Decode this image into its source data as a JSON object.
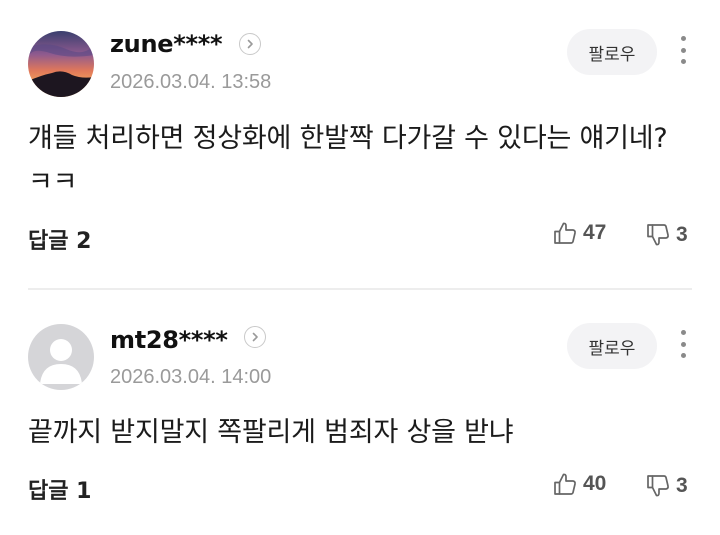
{
  "comments": [
    {
      "username": "zune****",
      "timestamp": "2026.03.04. 13:58",
      "follow_label": "팔로우",
      "text": "걔들 처리하면 정상화에 한발짝 다가갈 수 있다는 얘기네? ㅋㅋ",
      "reply_label": "답글 2",
      "likes": "47",
      "dislikes": "3",
      "avatar": "sunset-mountain-photo"
    },
    {
      "username": "mt28****",
      "timestamp": "2026.03.04. 14:00",
      "follow_label": "팔로우",
      "text": "끝까지 받지말지 쪽팔리게 범죄자 상을 받냐",
      "reply_label": "답글 1",
      "likes": "40",
      "dislikes": "3",
      "avatar": "default-user-avatar"
    }
  ],
  "colors": {
    "text": "#1b1b1b",
    "muted": "#9a9a9a",
    "follow_bg": "#f3f3f5",
    "divider": "#ededed"
  }
}
